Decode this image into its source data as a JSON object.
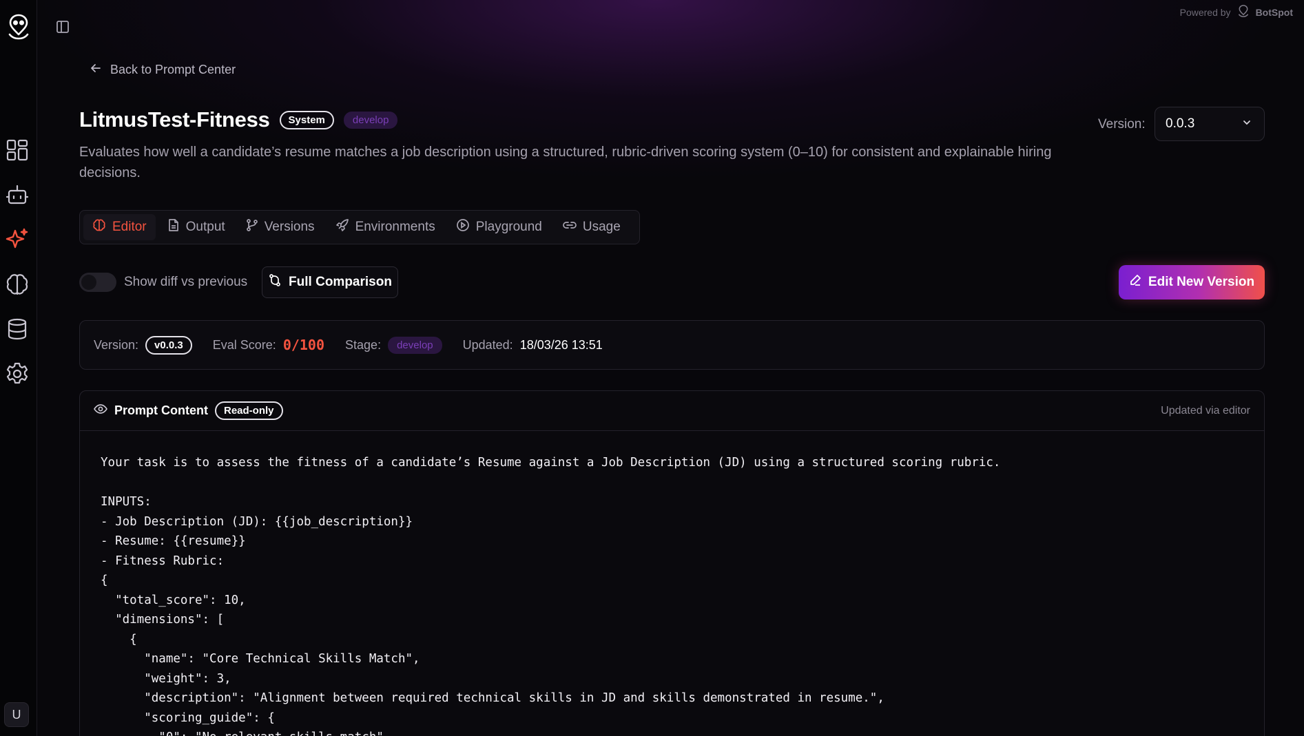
{
  "powered_by": {
    "prefix": "Powered by",
    "brand": "BotSpot"
  },
  "sidebar": {
    "items": [
      {
        "name": "dashboard",
        "icon": "grid-icon"
      },
      {
        "name": "bots",
        "icon": "robot-icon"
      },
      {
        "name": "prompts",
        "icon": "sparkle-icon",
        "active": true
      },
      {
        "name": "brain",
        "icon": "brain-icon"
      },
      {
        "name": "database",
        "icon": "database-icon"
      },
      {
        "name": "settings",
        "icon": "gear-icon"
      }
    ],
    "user_initial": "U"
  },
  "header": {
    "back_label": "Back to Prompt Center",
    "title": "LitmusTest-Fitness",
    "type_badge": "System",
    "env_badge": "develop",
    "description": "Evaluates how well a candidate’s resume matches a job description using a structured, rubric-driven scoring system (0–10) for consistent and explainable hiring decisions.",
    "version_label": "Version:",
    "version_value": "0.0.3"
  },
  "tabs": [
    {
      "label": "Editor",
      "icon": "brain-icon",
      "active": true
    },
    {
      "label": "Output",
      "icon": "file-icon"
    },
    {
      "label": "Versions",
      "icon": "git-branch-icon"
    },
    {
      "label": "Environments",
      "icon": "rocket-icon"
    },
    {
      "label": "Playground",
      "icon": "play-circle-icon"
    },
    {
      "label": "Usage",
      "icon": "link-icon"
    }
  ],
  "actions": {
    "diff_label": "Show diff vs previous",
    "diff_enabled": false,
    "full_comparison": "Full Comparison",
    "edit_new_version": "Edit New Version"
  },
  "info": {
    "version_label": "Version:",
    "version_value": "v0.0.3",
    "eval_label": "Eval Score:",
    "eval_value": "0/100",
    "stage_label": "Stage:",
    "stage_value": "develop",
    "updated_label": "Updated:",
    "updated_value": "18/03/26 13:51"
  },
  "prompt": {
    "title": "Prompt Content",
    "badge": "Read-only",
    "source": "Updated via editor",
    "content": "Your task is to assess the fitness of a candidate’s Resume against a Job Description (JD) using a structured scoring rubric.\n\nINPUTS:\n- Job Description (JD): {{job_description}}\n- Resume: {{resume}}\n- Fitness Rubric:\n{\n  \"total_score\": 10,\n  \"dimensions\": [\n    {\n      \"name\": \"Core Technical Skills Match\",\n      \"weight\": 3,\n      \"description\": \"Alignment between required technical skills in JD and skills demonstrated in resume.\",\n      \"scoring_guide\": {\n        \"0\": \"No relevant skills match\","
  },
  "colors": {
    "accent_red": "#f4533f",
    "accent_purple": "#7b3fb8",
    "background": "#08070b"
  }
}
